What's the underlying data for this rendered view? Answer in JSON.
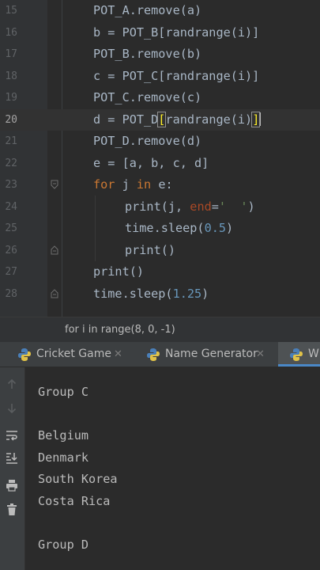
{
  "editor": {
    "lines": [
      {
        "num": "15",
        "code": "POT_A.remove(a)"
      },
      {
        "num": "16",
        "code": "b = POT_B[randrange(i)]"
      },
      {
        "num": "17",
        "code": "POT_B.remove(b)"
      },
      {
        "num": "18",
        "code": "c = POT_C[randrange(i)]"
      },
      {
        "num": "19",
        "code": "POT_C.remove(c)"
      },
      {
        "num": "20",
        "code": "d = POT_D[randrange(i)]"
      },
      {
        "num": "21",
        "code": "POT_D.remove(d)"
      },
      {
        "num": "22",
        "code": "e = [a, b, c, d]"
      },
      {
        "num": "23",
        "code": "for j in e:"
      },
      {
        "num": "24",
        "code": "print(j, end='  ')"
      },
      {
        "num": "25",
        "code": "time.sleep(0.5)"
      },
      {
        "num": "26",
        "code": "print()"
      },
      {
        "num": "27",
        "code": "print()"
      },
      {
        "num": "28",
        "code": "time.sleep(1.25)"
      }
    ],
    "current_line": "20"
  },
  "breadcrumb": {
    "text": "for i in range(8, 0, -1)"
  },
  "run_tabs": [
    {
      "label": "Cricket Game",
      "icon": "python-icon",
      "active": false
    },
    {
      "label": "Name Generator",
      "icon": "python-icon",
      "active": false
    },
    {
      "label": "W",
      "icon": "python-icon",
      "active": true
    }
  ],
  "run_toolbar": {
    "icons": [
      "arrow-up-icon",
      "arrow-down-icon",
      "soft-wrap-icon",
      "scroll-to-end-icon",
      "print-icon",
      "trash-icon"
    ]
  },
  "output": {
    "lines": [
      "Group C",
      "",
      "Belgium",
      "Denmark",
      "South Korea",
      "Costa Rica",
      "",
      "Group D"
    ]
  },
  "colors": {
    "editor_bg": "#2b2b2b",
    "keyword": "#cc7832",
    "number": "#6897bb",
    "string": "#6a8759",
    "kwarg": "#aa4926",
    "text": "#a9b7c6",
    "tab_underline": "#4a88c7"
  }
}
